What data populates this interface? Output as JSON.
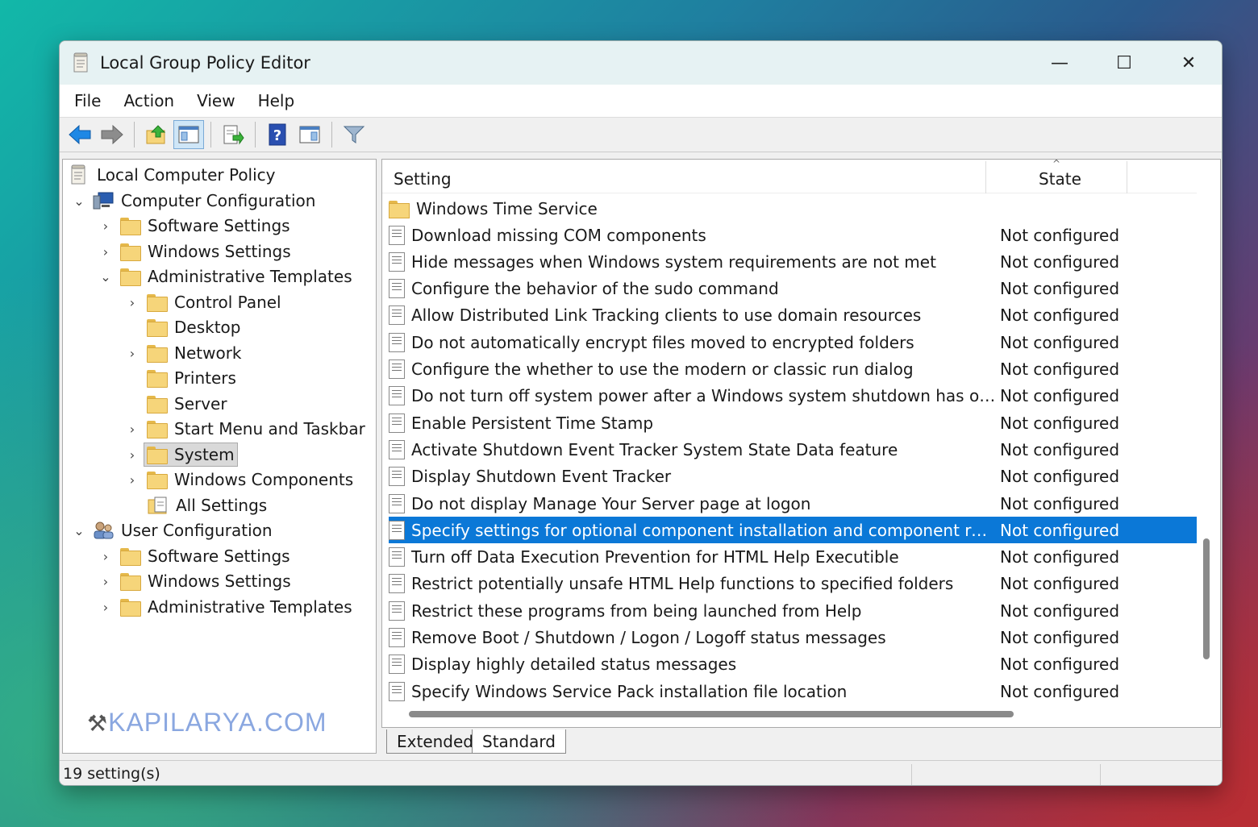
{
  "window": {
    "title": "Local Group Policy Editor",
    "minimize_glyph": "—",
    "maximize_glyph": "☐",
    "close_glyph": "✕"
  },
  "menu": [
    "File",
    "Action",
    "View",
    "Help"
  ],
  "tree": {
    "root": "Local Computer Policy",
    "computer_configuration": "Computer Configuration",
    "cc_software_settings": "Software Settings",
    "cc_windows_settings": "Windows Settings",
    "cc_admin_templates": "Administrative Templates",
    "control_panel": "Control Panel",
    "desktop": "Desktop",
    "network": "Network",
    "printers": "Printers",
    "server": "Server",
    "start_menu": "Start Menu and Taskbar",
    "system": "System",
    "windows_components": "Windows Components",
    "all_settings": "All Settings",
    "user_configuration": "User Configuration",
    "uc_software_settings": "Software Settings",
    "uc_windows_settings": "Windows Settings",
    "uc_admin_templates": "Administrative Templates"
  },
  "watermark": "KAPILARYA.COM",
  "list": {
    "header_setting": "Setting",
    "header_state": "State",
    "sort_glyph": "^",
    "folder_row": "Windows Time Service",
    "rows": [
      {
        "name": "Download missing COM components",
        "state": "Not configured"
      },
      {
        "name": "Hide messages when Windows system requirements are not met",
        "state": "Not configured"
      },
      {
        "name": "Configure the behavior of the sudo command",
        "state": "Not configured"
      },
      {
        "name": "Allow Distributed Link Tracking clients to use domain resources",
        "state": "Not configured"
      },
      {
        "name": "Do not automatically encrypt files moved to encrypted folders",
        "state": "Not configured"
      },
      {
        "name": "Configure the whether to use the modern or classic run dialog",
        "state": "Not configured"
      },
      {
        "name": "Do not turn off system power after a Windows system shutdown has occurr...",
        "state": "Not configured"
      },
      {
        "name": "Enable Persistent Time Stamp",
        "state": "Not configured"
      },
      {
        "name": "Activate Shutdown Event Tracker System State Data feature",
        "state": "Not configured"
      },
      {
        "name": "Display Shutdown Event Tracker",
        "state": "Not configured"
      },
      {
        "name": "Do not display Manage Your Server page at logon",
        "state": "Not configured"
      },
      {
        "name": "Specify settings for optional component installation and component repair",
        "state": "Not configured"
      },
      {
        "name": "Turn off Data Execution Prevention for HTML Help Executible",
        "state": "Not configured"
      },
      {
        "name": "Restrict potentially unsafe HTML Help functions to specified folders",
        "state": "Not configured"
      },
      {
        "name": "Restrict these programs from being launched from Help",
        "state": "Not configured"
      },
      {
        "name": "Remove Boot / Shutdown / Logon / Logoff status messages",
        "state": "Not configured"
      },
      {
        "name": "Display highly detailed status messages",
        "state": "Not configured"
      },
      {
        "name": "Specify Windows Service Pack installation file location",
        "state": "Not configured"
      }
    ]
  },
  "tabs": {
    "extended": "Extended",
    "standard": "Standard"
  },
  "status": "19 setting(s)",
  "colors": {
    "selection": "#0b78d7",
    "titlebar": "#e6f2f3"
  }
}
